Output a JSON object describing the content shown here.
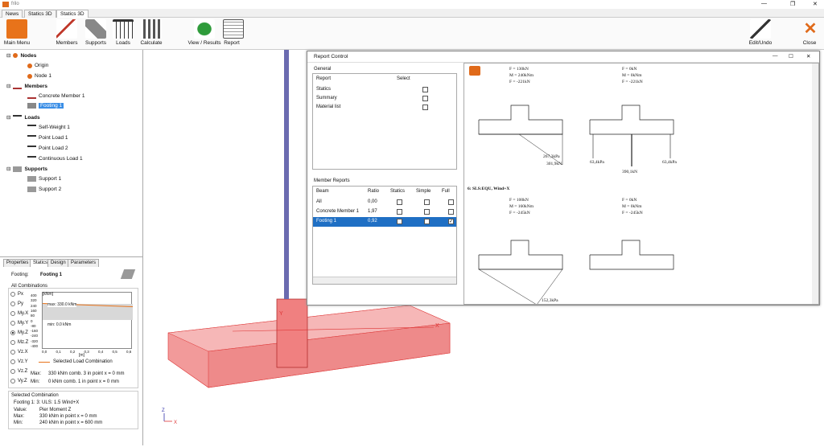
{
  "app": {
    "title": "frilo",
    "tabs": [
      "News",
      "Statics 3D",
      "Statics 3D"
    ],
    "window_controls": [
      "—",
      "❐",
      "✕"
    ]
  },
  "ribbon": {
    "main_menu": "Main Menu",
    "members": "Members",
    "supports": "Supports",
    "loads": "Loads",
    "calculate": "Calculate",
    "view_results": "View / Results",
    "report": "Report",
    "edit_undo": "Edit/Undo",
    "close": "Close"
  },
  "tree": {
    "nodes": "Nodes",
    "origin": "Origin",
    "node1": "Node 1",
    "members": "Members",
    "concrete_member": "Concrete Member 1",
    "footing": "Footing 1",
    "loads": "Loads",
    "self_weight": "Self-Weight 1",
    "point_load1": "Point Load 1",
    "point_load2": "Point Load 2",
    "continuous_load": "Continuous Load 1",
    "supports": "Supports",
    "support1": "Support 1",
    "support2": "Support 2"
  },
  "props": {
    "tabs": [
      "Properties",
      "Statics",
      "Design",
      "Parameters"
    ],
    "footing_label": "Footing:",
    "footing_value": "Footing 1",
    "all_combinations": "All Combinations",
    "radios": [
      "Px",
      "Py",
      "My.X",
      "My.Y",
      "My.Z",
      "Mz.Z",
      "Vz.X",
      "Vz.Y",
      "Vz.Z",
      "Vy.Z"
    ],
    "chart_unit": "[kNm]",
    "max_label": "max: 330.0 kNm",
    "min_label": "min: 0.0 kNm",
    "y_ticks": [
      "400",
      "320",
      "240",
      "160",
      "80",
      "0",
      "-80",
      "-160",
      "-240",
      "-320",
      "-400"
    ],
    "x_ticks": [
      "0,0",
      "0,1",
      "0,2",
      "0,3",
      "0,4",
      "0,5",
      "0,6"
    ],
    "x_unit": "[m]",
    "legend": "Selected Load Combination",
    "max_text": "Max:",
    "max_value": "330 kNm comb. 3 in point x = 0 mm",
    "min_text": "Min:",
    "min_value": "0 kNm comb. 1 in point x = 0 mm",
    "sel_comb": "Selected Combination",
    "sc_line1": "Footing 1: 3: ULS: 1.5 Wind+X",
    "value_label": "Value:",
    "value": "Pier Moment Z",
    "sc_max_label": "Max:",
    "sc_max": "330 kNm in point x = 0 mm",
    "sc_min_label": "Min:",
    "sc_min": "240 kNm in point x = 600 mm"
  },
  "report": {
    "title": "Report Control",
    "general": "General",
    "col_report": "Report",
    "col_select": "Select",
    "items": [
      "Statics",
      "Summary",
      "Material list"
    ],
    "member_reports": "Member Reports",
    "cols": [
      "Beam",
      "Ratio",
      "Statics",
      "Simple",
      "Full"
    ],
    "rows": [
      {
        "beam": "All",
        "ratio": "0,00"
      },
      {
        "beam": "Concrete Member 1",
        "ratio": "1,97"
      },
      {
        "beam": "Footing 1",
        "ratio": "0,92"
      }
    ]
  },
  "doc": {
    "f1a": "F  = 130kN",
    "m1": "M  = 240kNm",
    "f1b": "F  = -221kN",
    "f2a": "F  = 0kN",
    "m2": "M  = 0kNm",
    "f2b": "F  = -221kN",
    "p1": "267,3kPa",
    "p2": "301,9kN",
    "p3": "63,4kPa",
    "p4": "63,4kPa",
    "p5": "390,1kN",
    "section": "6: SLS:EQU, Wind+X",
    "f3a": "F  = 100kN",
    "m3": "M  = 160kNm",
    "f3b": "F  = -245kN",
    "f4a": "F  = 0kN",
    "m4": "M  = 0kNm",
    "f4b": "F  = -245kN",
    "p6": "152,3kPa"
  },
  "axes": {
    "x": "X",
    "y": "Y",
    "z": "Z"
  }
}
